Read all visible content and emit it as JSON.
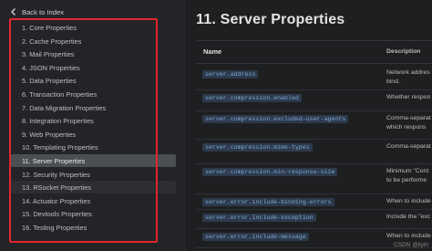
{
  "sidebar": {
    "back_label": "Back to Index",
    "items": [
      {
        "label": "1. Core Properties"
      },
      {
        "label": "2. Cache Properties"
      },
      {
        "label": "3. Mail Properties"
      },
      {
        "label": "4. JSON Properties"
      },
      {
        "label": "5. Data Properties"
      },
      {
        "label": "6. Transaction Properties"
      },
      {
        "label": "7. Data Migration Properties"
      },
      {
        "label": "8. Integration Properties"
      },
      {
        "label": "9. Web Properties"
      },
      {
        "label": "10. Templating Properties"
      },
      {
        "label": "11. Server Properties",
        "active": true
      },
      {
        "label": "12. Security Properties"
      },
      {
        "label": "13. RSocket Properties"
      },
      {
        "label": "14. Actuator Properties"
      },
      {
        "label": "15. Devtools Properties"
      },
      {
        "label": "16. Testing Properties"
      }
    ]
  },
  "main": {
    "title": "11. Server Properties",
    "table": {
      "headers": {
        "name": "Name",
        "description": "Description"
      },
      "rows": [
        {
          "name": "server.address",
          "desc": [
            "Network addres",
            "bind."
          ]
        },
        {
          "name": "server.compression.enabled",
          "desc": [
            "Whether respon"
          ]
        },
        {
          "name": "server.compression.excluded-user-agents",
          "desc": [
            "Comma-separat",
            "which respons"
          ]
        },
        {
          "name": "server.compression.mime-types",
          "desc": [
            "Comma-separat"
          ]
        },
        {
          "name": "server.compression.min-response-size",
          "desc": [
            "Minimum \"Cont",
            "to be performe"
          ]
        },
        {
          "name": "server.error.include-binding-errors",
          "desc": [
            "When to include"
          ]
        },
        {
          "name": "server.error.include-exception",
          "desc": [
            "Include the \"exc"
          ]
        },
        {
          "name": "server.error.include-message",
          "desc": [
            "When to include"
          ]
        }
      ]
    }
  },
  "watermark": "CSDN @liyih",
  "colors": {
    "accent_border": "#e0262b",
    "code_bg": "#2d3a4c",
    "code_text": "#7fa7d4",
    "background": "#1e1f21"
  }
}
